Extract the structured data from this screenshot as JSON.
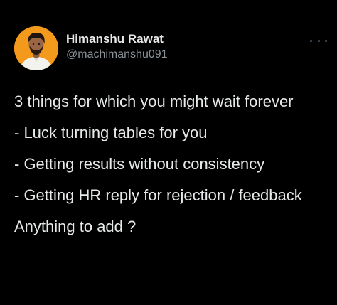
{
  "author": {
    "display_name": "Himanshu Rawat",
    "handle": "@machimanshu091"
  },
  "tweet": {
    "paragraphs": [
      "3 things for which you might wait forever",
      "- Luck turning tables for you",
      "- Getting results without consistency",
      "- Getting HR reply for rejection / feedback",
      "Anything to add ?"
    ]
  },
  "icons": {
    "menu": "more-horizontal-icon",
    "avatar": "profile-photo"
  },
  "colors": {
    "background": "#000000",
    "text_primary": "#e7e9ea",
    "text_secondary": "#8b9298",
    "avatar_background": "#f39a1c"
  }
}
